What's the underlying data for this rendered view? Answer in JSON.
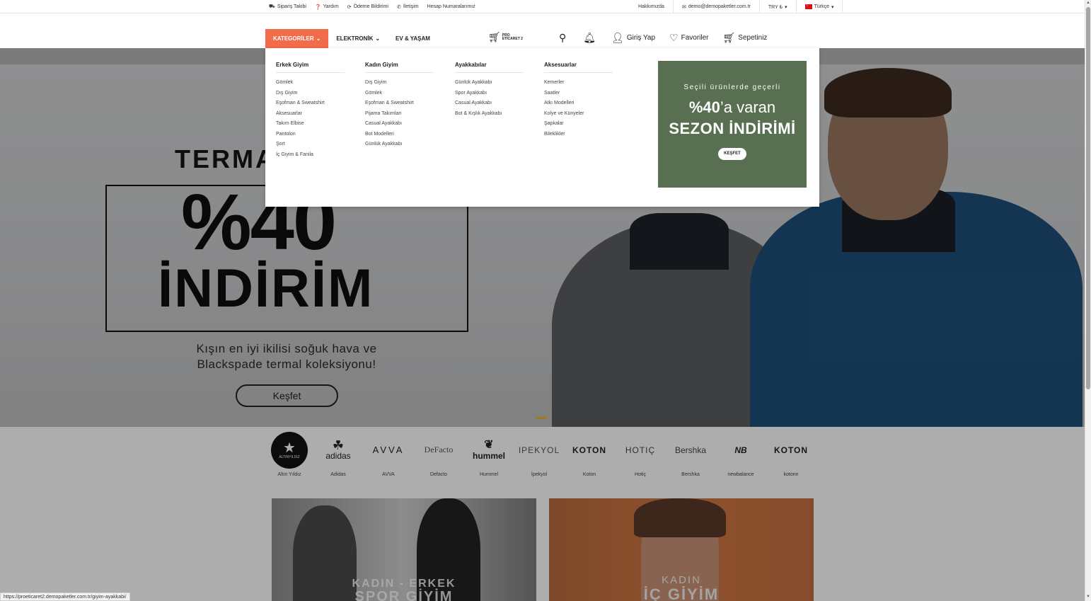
{
  "topbar": {
    "left": [
      {
        "icon": "truck-icon",
        "glyph": "⛟",
        "label": "Sipariş Takibi"
      },
      {
        "icon": "help-icon",
        "glyph": "❓",
        "label": "Yardım"
      },
      {
        "icon": "refresh-icon",
        "glyph": "⟳",
        "label": "Ödeme Bildirimi"
      },
      {
        "icon": "phone-icon",
        "glyph": "✆",
        "label": "İletişim"
      },
      {
        "icon": "",
        "glyph": "",
        "label": "Hesap Numaralarımız"
      }
    ],
    "about": "Hakkımızda",
    "email": "demo@demopaketler.com.tr",
    "currency": "TRY ₺",
    "language": "Türkçe"
  },
  "nav": {
    "categories": "KATEGORİLER",
    "electronics": "ELEKTRONİK",
    "home_living": "EV & YAŞAM"
  },
  "logo": {
    "line1": "PRO",
    "line2": "ETİCARET 2"
  },
  "header_actions": {
    "login": "Giriş Yap",
    "favorites": "Favoriler",
    "cart": "Sepetiniz"
  },
  "mega_menu": {
    "columns": [
      {
        "title": "Erkek Giyim",
        "items": [
          "Gömlek",
          "Dış Giyim",
          "Eşofman & Sweatshirt",
          "Aksesuarlar",
          "Takım Elbise",
          "Pantolon",
          "Şort",
          "İç Giyim & Fanila"
        ]
      },
      {
        "title": "Kadın Giyim",
        "items": [
          "Dış Giyim",
          "Gömlek",
          "Eşofman & Sweatshirt",
          "Pijama Takımları",
          "Casual Ayakkabı",
          "Bot Modelleri",
          "Günlük Ayakkabı"
        ]
      },
      {
        "title": "Ayakkabılar",
        "items": [
          "Günlük Ayakkabı",
          "Spor Ayakkabı",
          "Casual Ayakkabı",
          "Bot & Kışlık Ayakkabı"
        ]
      },
      {
        "title": "Aksesuarlar",
        "items": [
          "Kemerler",
          "Saatler",
          "Atkı Modelleri",
          "Kolye ve Künyeler",
          "Şapkalar",
          "Bileklikler"
        ]
      }
    ],
    "promo": {
      "line1": "Seçili ürünlerde geçerli",
      "pct": "%40",
      "line2_rest": "’a varan",
      "line3": "SEZON İNDİRİMİ",
      "button": "KEŞFET",
      "bg_color": "#586f51"
    }
  },
  "hero": {
    "word": "TERMA",
    "pct": "%40",
    "discount": "İNDİRİM",
    "subtitle_line1": "Kışın en iyi ikilisi soğuk hava ve",
    "subtitle_line2": "Blackspade termal koleksiyonu!",
    "button": "Keşfet"
  },
  "brands": [
    {
      "name": "Altın Yıldız",
      "logo": "ALTINYILDIZ"
    },
    {
      "name": "Adidas",
      "logo": "adidas"
    },
    {
      "name": "AVVA",
      "logo": "AVVA"
    },
    {
      "name": "Defacto",
      "logo": "DeFacto"
    },
    {
      "name": "Hummel",
      "logo": "hummel"
    },
    {
      "name": "İpekyol",
      "logo": "IPEKYOL"
    },
    {
      "name": "Koton",
      "logo": "KOTON"
    },
    {
      "name": "Hotiç",
      "logo": "HOTIÇ"
    },
    {
      "name": "Bershka",
      "logo": "Bershka"
    },
    {
      "name": "newbalance",
      "logo": "NB"
    },
    {
      "name": "kotonn",
      "logo": "KOTON"
    }
  ],
  "banners": [
    {
      "line1": "KADIN - ERKEK",
      "line2": "SPOR GİYİM"
    },
    {
      "line1": "KADIN",
      "line2": "İÇ GİYİM"
    }
  ],
  "status_url": "https://proeticaret2.demopaketler.com.tr/giyim-ayakkabi/",
  "accent_color": "#f26b4b"
}
